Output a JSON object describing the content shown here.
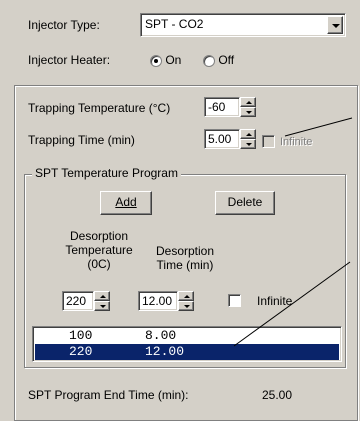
{
  "injector": {
    "type_label": "Injector Type:",
    "type_value": "SPT - CO2",
    "heater_label": "Injector Heater:",
    "heater_on": "On",
    "heater_off": "Off",
    "heater_selected": "On"
  },
  "trapping": {
    "temp_label": "Trapping Temperature (°C)",
    "temp_value": "-60",
    "time_label": "Trapping Time (min)",
    "time_value": "5.00",
    "infinite_label": "Infinite"
  },
  "program": {
    "group_title": "SPT Temperature Program",
    "add_label": "Add",
    "delete_label": "Delete",
    "desorp_temp_header": [
      "Desorption",
      "Temperature",
      "(0C)"
    ],
    "desorp_time_header": [
      "Desorption",
      "Time (min)"
    ],
    "temp_value": "220",
    "time_value": "12.00",
    "infinite_label": "Infinite",
    "rows": [
      {
        "temp": "100",
        "time": "8.00",
        "selected": false
      },
      {
        "temp": "220",
        "time": "12.00",
        "selected": true
      }
    ]
  },
  "end_time": {
    "label": "SPT Program End Time (min):",
    "value": "25.00"
  },
  "colors": {
    "dialog_bg": "#d4d0c8",
    "selection": "#0a246a"
  }
}
